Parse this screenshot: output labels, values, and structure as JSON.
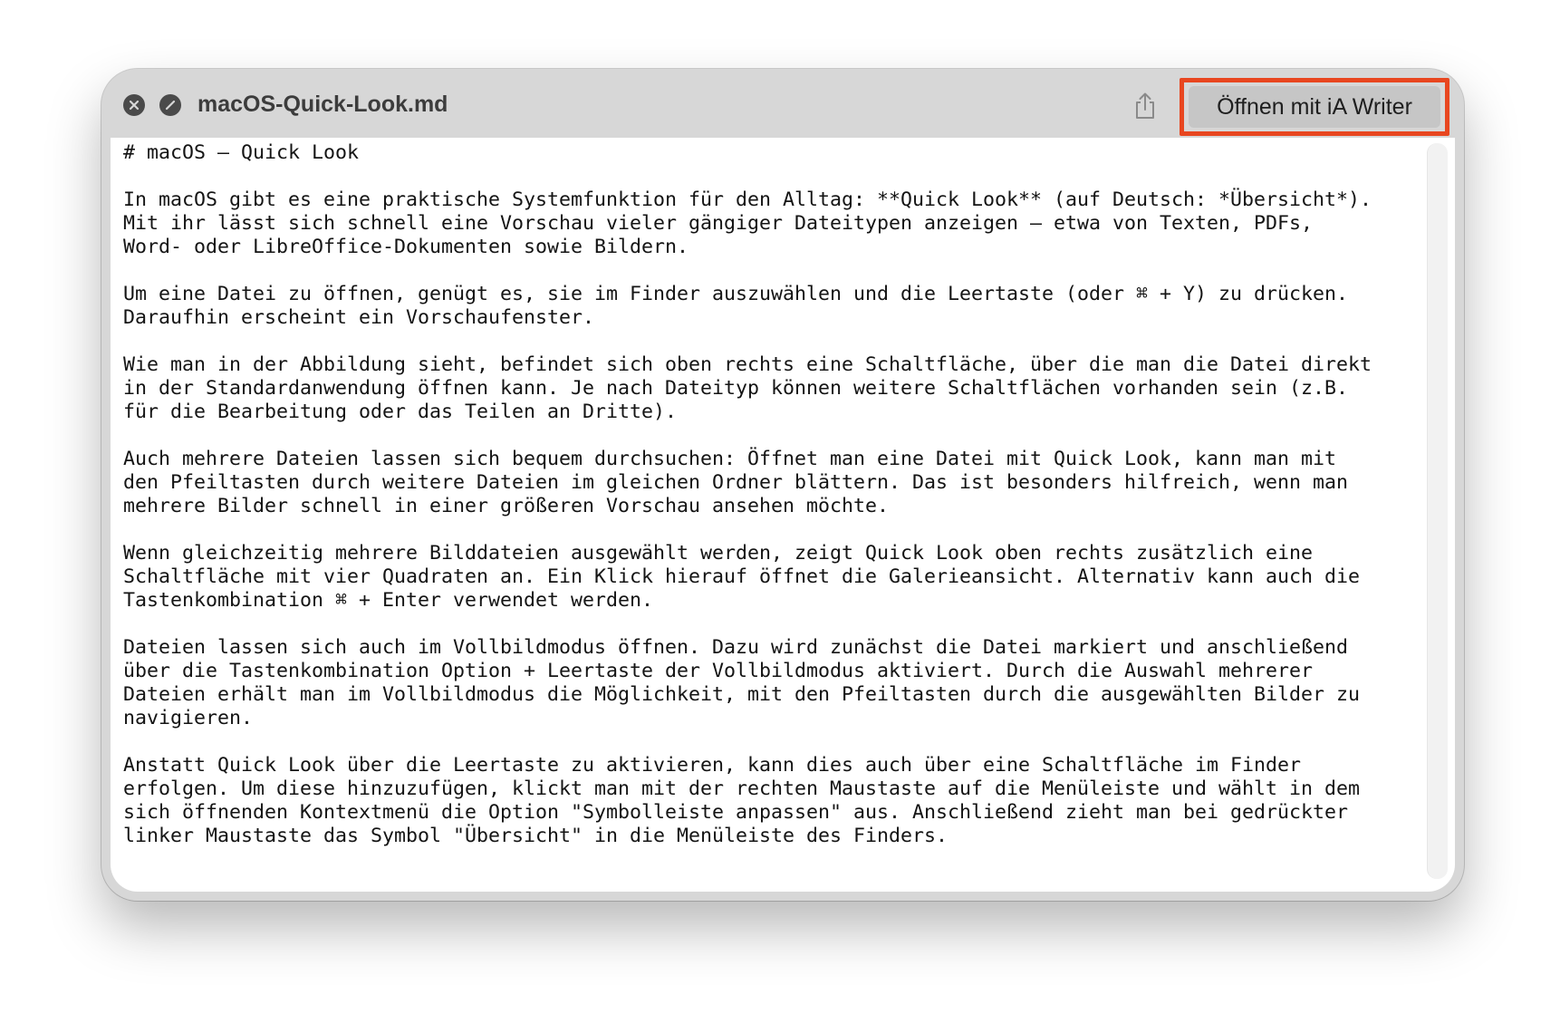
{
  "window": {
    "title": "macOS-Quick-Look.md",
    "open_button_label": "Öffnen mit iA Writer",
    "icons": {
      "close": "close-icon",
      "minimize": "fullscreen-icon",
      "share": "share-icon"
    },
    "highlight_color": "#e8461f"
  },
  "document": {
    "lines": [
      "# macOS – Quick Look",
      "",
      "In macOS gibt es eine praktische Systemfunktion für den Alltag: **Quick Look** (auf Deutsch: *Übersicht*).",
      "Mit ihr lässt sich schnell eine Vorschau vieler gängiger Dateitypen anzeigen – etwa von Texten, PDFs,",
      "Word- oder LibreOffice-Dokumenten sowie Bildern.",
      "",
      "Um eine Datei zu öffnen, genügt es, sie im Finder auszuwählen und die Leertaste (oder ⌘ + Y) zu drücken.",
      "Daraufhin erscheint ein Vorschaufenster.",
      "",
      "Wie man in der Abbildung sieht, befindet sich oben rechts eine Schaltfläche, über die man die Datei direkt",
      "in der Standardanwendung öffnen kann. Je nach Dateityp können weitere Schaltflächen vorhanden sein (z.B.",
      "für die Bearbeitung oder das Teilen an Dritte).",
      "",
      "Auch mehrere Dateien lassen sich bequem durchsuchen: Öffnet man eine Datei mit Quick Look, kann man mit",
      "den Pfeiltasten durch weitere Dateien im gleichen Ordner blättern. Das ist besonders hilfreich, wenn man",
      "mehrere Bilder schnell in einer größeren Vorschau ansehen möchte.",
      "",
      "Wenn gleichzeitig mehrere Bilddateien ausgewählt werden, zeigt Quick Look oben rechts zusätzlich eine",
      "Schaltfläche mit vier Quadraten an. Ein Klick hierauf öffnet die Galerieansicht. Alternativ kann auch die",
      "Tastenkombination ⌘ + Enter verwendet werden.",
      "",
      "Dateien lassen sich auch im Vollbildmodus öffnen. Dazu wird zunächst die Datei markiert und anschließend",
      "über die Tastenkombination Option + Leertaste der Vollbildmodus aktiviert. Durch die Auswahl mehrerer",
      "Dateien erhält man im Vollbildmodus die Möglichkeit, mit den Pfeiltasten durch die ausgewählten Bilder zu",
      "navigieren.",
      "",
      "Anstatt Quick Look über die Leertaste zu aktivieren, kann dies auch über eine Schaltfläche im Finder",
      "erfolgen. Um diese hinzuzufügen, klickt man mit der rechten Maustaste auf die Menüleiste und wählt in dem",
      "sich öffnenden Kontextmenü die Option \"Symbolleiste anpassen\" aus. Anschließend zieht man bei gedrückter",
      "linker Maustaste das Symbol \"Übersicht\" in die Menüleiste des Finders."
    ]
  }
}
